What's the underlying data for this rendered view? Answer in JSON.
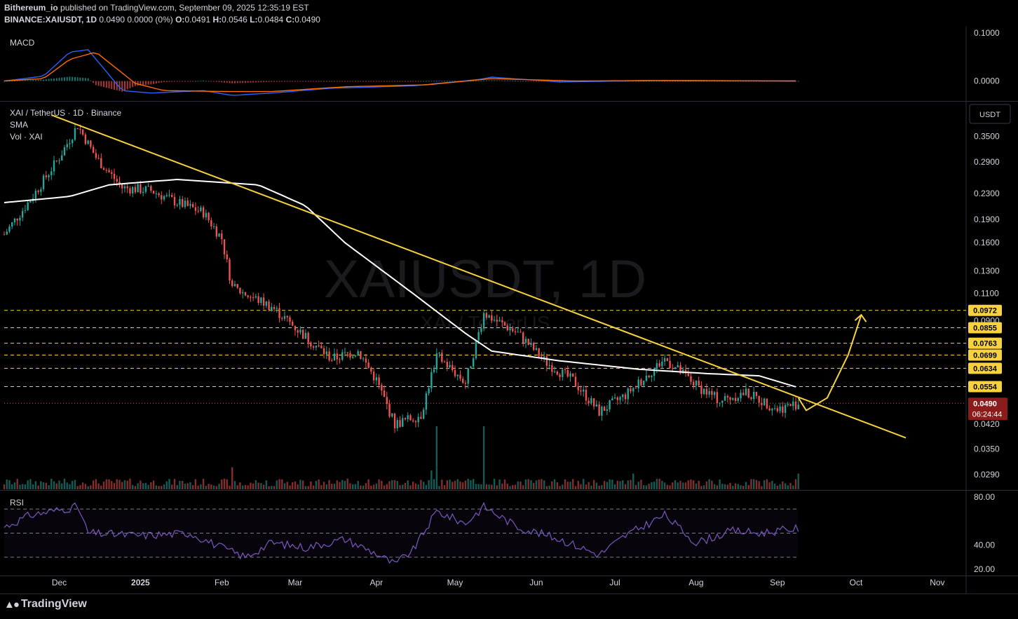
{
  "header": {
    "publisher": "Bithereum_io",
    "published_line": " published on TradingView.com, September 09, 2025 12:35:19 EST",
    "symbol": "BINANCE:XAIUSDT, 1D",
    "last_line": " 0.0490 0.0000 (0%) ",
    "ohlc": {
      "o": "0.0491",
      "h": "0.0546",
      "l": "0.0484",
      "c": "0.0490"
    }
  },
  "panes": {
    "macd_label": "MACD",
    "main_title": "XAI / TetherUS · 1D · Binance",
    "sma_label": "SMA",
    "vol_label": "Vol · XAI",
    "rsi_label": "RSI",
    "watermark": "XAIUSDT, 1D",
    "watermark_sub": "XAI / TetherUS",
    "currency_button": "USDT"
  },
  "footer": {
    "brand": "TradingView"
  },
  "colors": {
    "background": "#000000",
    "up": "#26a69a",
    "down": "#ef5350",
    "trendline": "#f7d23e",
    "sma": "#ffffff",
    "macd": "#2962ff",
    "signal": "#ff6d00",
    "rsi": "#7e57c2",
    "level_label_bg": "#f7d23e",
    "price_label_bg": "#8c1c1c"
  },
  "chart_data": {
    "type": "candlestick",
    "symbol": "BINANCE:XAIUSDT",
    "interval": "1D",
    "x_range": [
      "2024-11-10",
      "2025-11-12"
    ],
    "x_ticks": [
      "Dec",
      "2025",
      "Feb",
      "Mar",
      "Apr",
      "May",
      "Jun",
      "Jul",
      "Aug",
      "Sep",
      "Oct",
      "Nov"
    ],
    "y_scale": "log",
    "y_range": [
      0.026,
      0.45
    ],
    "y_ticks": [
      "0.3500",
      "0.2900",
      "0.2300",
      "0.1900",
      "0.1600",
      "0.1300",
      "0.1100",
      "0.0900",
      "0.0420",
      "0.0350",
      "0.0290"
    ],
    "last_price": "0.0490",
    "countdown": "06:24:44",
    "ohlc_last": {
      "open": 0.0491,
      "high": 0.0546,
      "low": 0.0484,
      "close": 0.049
    },
    "price_path": [
      [
        "2024-11-10",
        0.17
      ],
      [
        "2024-11-20",
        0.22
      ],
      [
        "2024-12-01",
        0.3
      ],
      [
        "2024-12-08",
        0.38
      ],
      [
        "2024-12-15",
        0.3
      ],
      [
        "2024-12-25",
        0.24
      ],
      [
        "2025-01-05",
        0.235
      ],
      [
        "2025-01-15",
        0.215
      ],
      [
        "2025-01-25",
        0.2
      ],
      [
        "2025-02-01",
        0.165
      ],
      [
        "2025-02-05",
        0.115
      ],
      [
        "2025-02-20",
        0.1
      ],
      [
        "2025-03-05",
        0.08
      ],
      [
        "2025-03-15",
        0.068
      ],
      [
        "2025-03-25",
        0.072
      ],
      [
        "2025-04-01",
        0.058
      ],
      [
        "2025-04-08",
        0.042
      ],
      [
        "2025-04-18",
        0.045
      ],
      [
        "2025-04-24",
        0.07
      ],
      [
        "2025-05-05",
        0.057
      ],
      [
        "2025-05-12",
        0.095
      ],
      [
        "2025-05-25",
        0.082
      ],
      [
        "2025-06-05",
        0.066
      ],
      [
        "2025-06-15",
        0.058
      ],
      [
        "2025-06-25",
        0.046
      ],
      [
        "2025-07-05",
        0.052
      ],
      [
        "2025-07-20",
        0.068
      ],
      [
        "2025-08-01",
        0.056
      ],
      [
        "2025-08-10",
        0.05
      ],
      [
        "2025-08-20",
        0.053
      ],
      [
        "2025-09-01",
        0.047
      ],
      [
        "2025-09-09",
        0.049
      ]
    ],
    "sma_path": [
      [
        "2024-11-10",
        0.215
      ],
      [
        "2024-12-05",
        0.225
      ],
      [
        "2024-12-20",
        0.245
      ],
      [
        "2025-01-15",
        0.255
      ],
      [
        "2025-02-15",
        0.245
      ],
      [
        "2025-03-05",
        0.21
      ],
      [
        "2025-03-20",
        0.16
      ],
      [
        "2025-04-15",
        0.11
      ],
      [
        "2025-05-05",
        0.082
      ],
      [
        "2025-05-15",
        0.072
      ],
      [
        "2025-06-10",
        0.067
      ],
      [
        "2025-07-10",
        0.063
      ],
      [
        "2025-08-05",
        0.061
      ],
      [
        "2025-08-25",
        0.06
      ],
      [
        "2025-09-09",
        0.055
      ]
    ],
    "trendline": {
      "from": [
        "2024-11-28",
        0.41
      ],
      "to": [
        "2025-10-20",
        0.038
      ]
    },
    "projection_path": [
      [
        "2025-09-09",
        0.051
      ],
      [
        "2025-09-12",
        0.0465
      ],
      [
        "2025-09-20",
        0.051
      ],
      [
        "2025-09-28",
        0.07
      ],
      [
        "2025-10-03",
        0.094
      ]
    ],
    "levels": [
      "0.0972",
      "0.0855",
      "0.0763",
      "0.0699",
      "0.0634",
      "0.0554"
    ],
    "volume_spikes": [
      [
        "2025-04-24",
        1.0
      ],
      [
        "2025-05-12",
        1.0
      ],
      [
        "2025-02-05",
        0.35
      ],
      [
        "2025-04-22",
        0.3
      ],
      [
        "2025-07-08",
        0.25
      ],
      [
        "2025-09-09",
        0.25
      ]
    ],
    "macd": {
      "y_ticks": [
        "0.1000",
        "0.0000"
      ],
      "y_range": [
        -0.04,
        0.11
      ],
      "macd_path": [
        [
          "2024-11-10",
          0.0
        ],
        [
          "2024-11-25",
          0.01
        ],
        [
          "2024-12-05",
          0.06
        ],
        [
          "2024-12-12",
          0.065
        ],
        [
          "2024-12-25",
          -0.02
        ],
        [
          "2025-01-05",
          -0.025
        ],
        [
          "2025-01-25",
          -0.02
        ],
        [
          "2025-02-05",
          -0.03
        ],
        [
          "2025-02-20",
          -0.025
        ],
        [
          "2025-03-15",
          -0.015
        ],
        [
          "2025-04-15",
          -0.01
        ],
        [
          "2025-05-10",
          0.003
        ],
        [
          "2025-05-15",
          0.008
        ],
        [
          "2025-06-10",
          -0.002
        ],
        [
          "2025-07-15",
          0.001
        ],
        [
          "2025-09-09",
          0.0
        ]
      ],
      "signal_path": [
        [
          "2024-11-10",
          0.0
        ],
        [
          "2024-11-25",
          0.005
        ],
        [
          "2024-12-05",
          0.045
        ],
        [
          "2024-12-15",
          0.06
        ],
        [
          "2024-12-30",
          -0.005
        ],
        [
          "2025-01-10",
          -0.02
        ],
        [
          "2025-02-05",
          -0.022
        ],
        [
          "2025-02-20",
          -0.022
        ],
        [
          "2025-03-20",
          -0.012
        ],
        [
          "2025-04-20",
          -0.008
        ],
        [
          "2025-05-15",
          0.005
        ],
        [
          "2025-06-15",
          0.0
        ],
        [
          "2025-07-20",
          0.001
        ],
        [
          "2025-09-09",
          0.0
        ]
      ]
    },
    "rsi": {
      "y_ticks": [
        "80.00",
        "40.00",
        "20.00"
      ],
      "y_range": [
        20,
        80
      ],
      "bands": [
        70,
        50,
        30
      ],
      "path": [
        [
          "2024-11-10",
          55
        ],
        [
          "2024-11-20",
          65
        ],
        [
          "2024-12-08",
          72
        ],
        [
          "2024-12-12",
          50
        ],
        [
          "2025-01-01",
          48
        ],
        [
          "2025-01-20",
          50
        ],
        [
          "2025-02-01",
          38
        ],
        [
          "2025-02-10",
          30
        ],
        [
          "2025-02-20",
          42
        ],
        [
          "2025-03-05",
          38
        ],
        [
          "2025-03-20",
          45
        ],
        [
          "2025-04-01",
          33
        ],
        [
          "2025-04-08",
          24
        ],
        [
          "2025-04-15",
          36
        ],
        [
          "2025-04-24",
          68
        ],
        [
          "2025-05-05",
          58
        ],
        [
          "2025-05-12",
          72
        ],
        [
          "2025-05-25",
          55
        ],
        [
          "2025-06-10",
          45
        ],
        [
          "2025-06-25",
          32
        ],
        [
          "2025-07-05",
          48
        ],
        [
          "2025-07-20",
          65
        ],
        [
          "2025-08-01",
          42
        ],
        [
          "2025-08-15",
          52
        ],
        [
          "2025-08-25",
          50
        ],
        [
          "2025-09-09",
          54
        ]
      ]
    }
  }
}
